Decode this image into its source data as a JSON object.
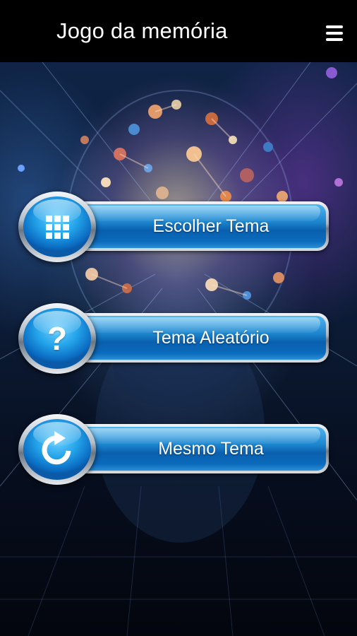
{
  "app_bar": {
    "title": "Jogo da memória",
    "menu_icon": "hamburger-menu-icon"
  },
  "menu": {
    "items": [
      {
        "label": "Escolher Tema",
        "icon": "grid-icon"
      },
      {
        "label": "Tema Aleatório",
        "icon": "question-mark-icon"
      },
      {
        "label": "Mesmo Tema",
        "icon": "refresh-icon"
      }
    ]
  },
  "colors": {
    "app_bar_bg": "#000000",
    "button_blue": "#1d86cf",
    "button_highlight": "#4fb6ef",
    "text": "#ffffff"
  }
}
